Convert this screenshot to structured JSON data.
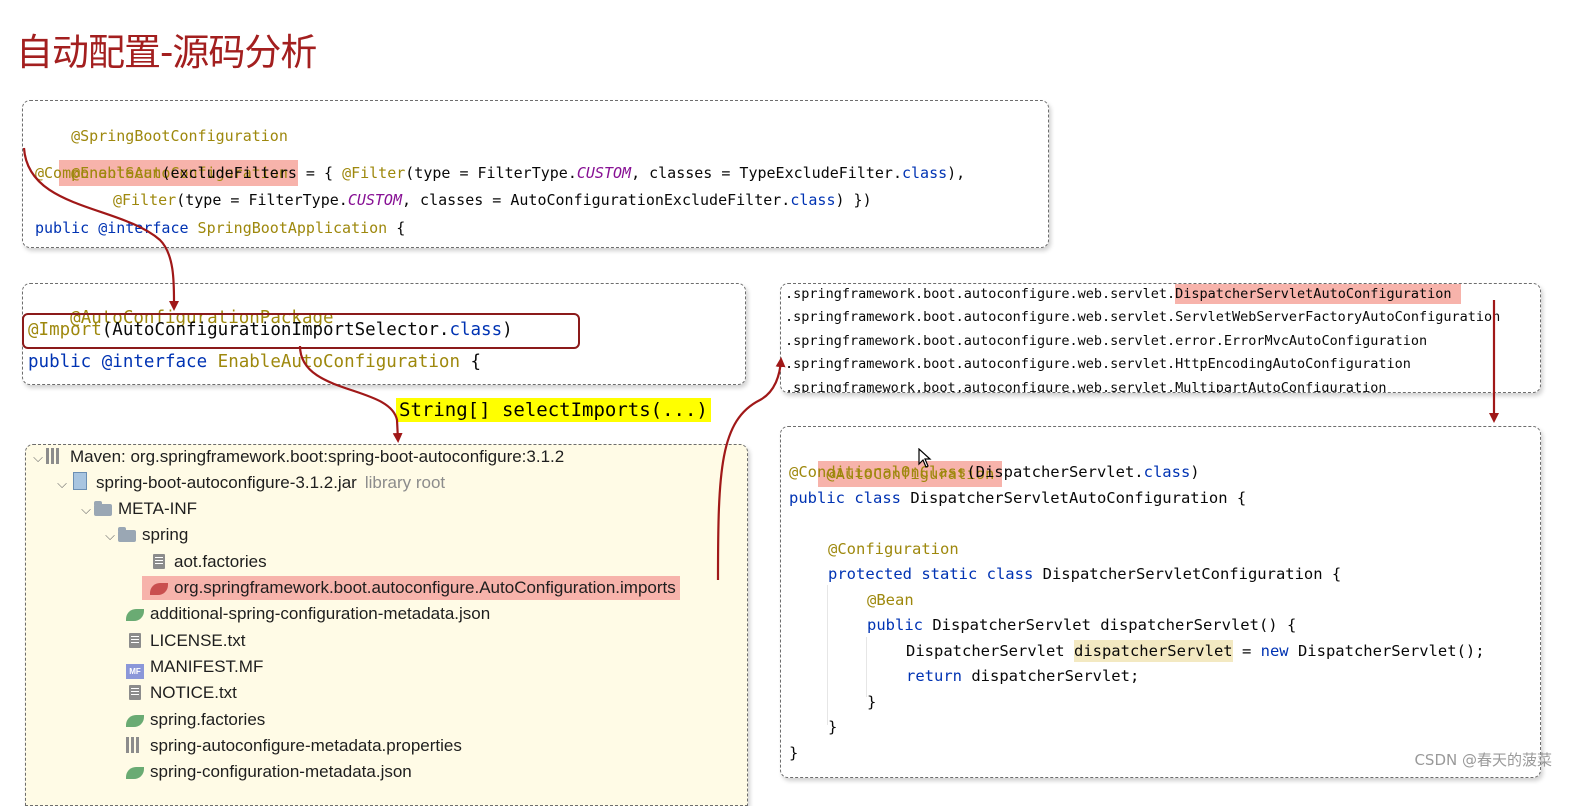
{
  "title": "自动配置-源码分析",
  "panel1": {
    "lines": [
      "@SpringBootConfiguration",
      "@EnableAutoConfiguration",
      "@ComponentScan",
      "(excludeFilters = { ",
      "@Filter",
      "(type = FilterType.",
      "CUSTOM",
      ", classes = TypeExcludeFilter.",
      "class",
      "),",
      "@Filter",
      "(type = FilterType.",
      "CUSTOM",
      ", classes = AutoConfigurationExcludeFilter.",
      "class",
      ") })",
      "public",
      " @interface",
      " SpringBootApplication",
      " {"
    ]
  },
  "panel2": {
    "l1": "@AutoConfigurationPackage",
    "l2_ann": "@Import",
    "l2_rest": "(AutoConfigurationImportSelector.",
    "l2_class": "class",
    "l2_end": ")",
    "l3_kw": "public",
    "l3_iface": " @interface",
    "l3_name": " EnableAutoConfiguration",
    "l3_end": " {"
  },
  "banner": "String[] selectImports(...)",
  "panel3": {
    "prefix": ".springframework.boot.autoconfigure.web.servlet.",
    "l1_highlight": "DispatcherServletAutoConfiguration",
    "l2": ".springframework.boot.autoconfigure.web.servlet.ServletWebServerFactoryAutoConfiguration",
    "l3_prefix": ".springframework.boot.autoconfigure.web.servlet.error.",
    "l3_name": "ErrorMvcAutoConfiguration",
    "l4": ".springframework.boot.autoconfigure.web.servlet.HttpEncodingAutoConfiguration",
    "l5": ".springframework.boot.autoconfigure.web.servlet.MultipartAutoConfiguration"
  },
  "tree": {
    "root": "Maven: org.springframework.boot:spring-boot-autoconfigure:3.1.2",
    "jar": "spring-boot-autoconfigure-3.1.2.jar",
    "jar_hint": "library root",
    "meta_inf": "META-INF",
    "spring": "spring",
    "aot": "aot.factories",
    "imports": "org.springframework.boot.autoconfigure.AutoConfiguration.imports",
    "additional": "additional-spring-configuration-metadata.json",
    "license": "LICENSE.txt",
    "manifest": "MANIFEST.MF",
    "notice": "NOTICE.txt",
    "factories": "spring.factories",
    "props": "spring-autoconfigure-metadata.properties",
    "config_meta": "spring-configuration-metadata.json"
  },
  "panel4": {
    "l1": "@AutoConfiguration",
    "l2_ann": "@ConditionalOnClass",
    "l2_rest": "(DispatcherServlet.",
    "l2_class": "class",
    "l2_end": ")",
    "l3_kw": "public class",
    "l3_rest": " DispatcherServletAutoConfiguration {",
    "l4": "@Configuration",
    "l5_kw": "protected static class",
    "l5_rest": " DispatcherServletConfiguration {",
    "l6": "@Bean",
    "l7_kw": "public",
    "l7_rest": " DispatcherServlet dispatcherServlet() {",
    "l8_a": "DispatcherServlet ",
    "l8_var": "dispatcherServlet",
    "l8_b": " = ",
    "l8_new": "new",
    "l8_c": " DispatcherServlet();",
    "l9_kw": "return",
    "l9_rest": " dispatcherServlet;",
    "l10": "}",
    "l11": "}",
    "l12": "}"
  },
  "watermark": "CSDN @春天的菠菜",
  "colors": {
    "accent": "#a31f1f",
    "highlight": "#f7b3ab",
    "banner": "#ffff00",
    "arrow": "#a01818"
  }
}
